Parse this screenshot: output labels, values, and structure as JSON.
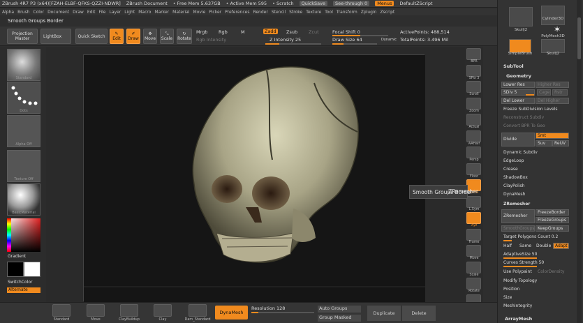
{
  "titlebar": {
    "app": "ZBrush 4R7 P3 (x64)[FZAH-ELBF-QFKS-QZZI-NDWR]",
    "document": "ZBrush Document",
    "free_mem": "• Free Mem 5.637GB",
    "active_mem": "• Active Mem 595",
    "scratch": "• Scratch",
    "quicksave": "QuickSave",
    "see_through": "See-through  0",
    "menus": "Menus",
    "default_script": "DefaultZScript"
  },
  "menubar": [
    "Alpha",
    "Brush",
    "Color",
    "Document",
    "Draw",
    "Edit",
    "File",
    "Layer",
    "Light",
    "Macro",
    "Marker",
    "Material",
    "Movie",
    "Picker",
    "Preferences",
    "Render",
    "Stencil",
    "Stroke",
    "Texture",
    "Tool",
    "Transform",
    "Zplugin",
    "Zscript"
  ],
  "note": "Smooth Groups Border",
  "toolbar": {
    "projection_master": "Projection Master",
    "lightbox": "LightBox",
    "quick_sketch": "Quick Sketch",
    "edit": "Edit",
    "draw": "Draw",
    "move": "Move",
    "scale": "Scale",
    "rotate": "Rotate",
    "mrgb": "Mrgb",
    "rgb": "Rgb",
    "m": "M",
    "rgb_intensity": "Rgb Intensity",
    "zadd": "Zadd",
    "zsub": "Zsub",
    "zcut": "Zcut",
    "z_intensity": "Z Intensity 25",
    "focal_shift": "Focal Shift 0",
    "draw_size": "Draw Size 64",
    "dynamic": "Dynamic",
    "active_points": "ActivePoints: 488,514",
    "total_points": "TotalPoints: 3.496 Mil"
  },
  "leftshelf": {
    "items": [
      "Standard",
      "Dots",
      "Alpha Off",
      "Texture Off",
      "BasicMaterial"
    ],
    "gradient": "Gradient",
    "switch_color": "SwitchColor",
    "alternate": "Alternate"
  },
  "rightshelf": [
    "BPR",
    "SPix 3",
    "Scroll",
    "Zoom",
    "Actual",
    "AAHalf",
    "Persp",
    "Floor",
    "Local",
    "L.Sym",
    "Xyz",
    "Frame",
    "Move",
    "Scale",
    "Rotate",
    "PolyF"
  ],
  "tooltip": {
    "text": "Smooth Groups Border",
    "extra": "ZRemesher"
  },
  "rightpanel": {
    "brushes": [
      "SkullJ2",
      "Cylinder3D",
      "PolyMesh3D",
      "SimpleBrush",
      "SkullJ2"
    ],
    "subtool": "SubTool",
    "geometry": "Geometry",
    "lower_res": "Lower Res",
    "higher_res": "Higher Res",
    "sdiv": "SDiv 5",
    "cage": "Cage",
    "rstr": "Rstr",
    "del_lower": "Del Lower",
    "del_higher": "Del Higher",
    "freeze_subdiv": "Freeze SubDivision Levels",
    "reconstruct": "Reconstruct Subdiv",
    "convert_bpr": "Convert BPR To Geo",
    "divide": "Divide",
    "smt": "Smt",
    "suv": "Suv",
    "reuv": "ReUV",
    "dynamic_subdiv": "Dynamic Subdiv",
    "edgeloop": "EdgeLoop",
    "crease": "Crease",
    "shadowbox": "ShadowBox",
    "claypolish": "ClayPolish",
    "dynamesh": "DynaMesh",
    "zremesher_h": "ZRemesher",
    "zremesher": "ZRemesher",
    "freeze_border": "FreezeBorder",
    "freeze_groups": "FreezeGroups",
    "smooth_groups": "SmoothGroups",
    "keep_groups": "KeepGroups",
    "target_poly": "Target Polygons Count 0.2",
    "half": "Half",
    "same": "Same",
    "double": "Double",
    "adapt": "Adapt",
    "adaptive_size": "AdaptiveSize 50",
    "curves_strength": "Curves Strength 50",
    "use_polypaint": "Use Polypaint",
    "color_density": "ColorDensity",
    "modify_topology": "Modify Topology",
    "position": "Position",
    "size": "Size",
    "mesh_integrity": "MeshIntegrity",
    "arraymesh": "ArrayMesh"
  },
  "bottombar": {
    "brushes": [
      "Standard",
      "Move",
      "ClayBuildup",
      "Clay",
      "Dam_Standard"
    ],
    "dynamesh": "DynaMesh",
    "resolution": "Resolution 128",
    "auto_groups": "Auto Groups",
    "group_masked": "Group Masked",
    "duplicate": "Duplicate",
    "delete": "Delete"
  },
  "colors": {
    "accent": "#f08a1e",
    "panel": "#333333",
    "canvas": "#151515"
  }
}
